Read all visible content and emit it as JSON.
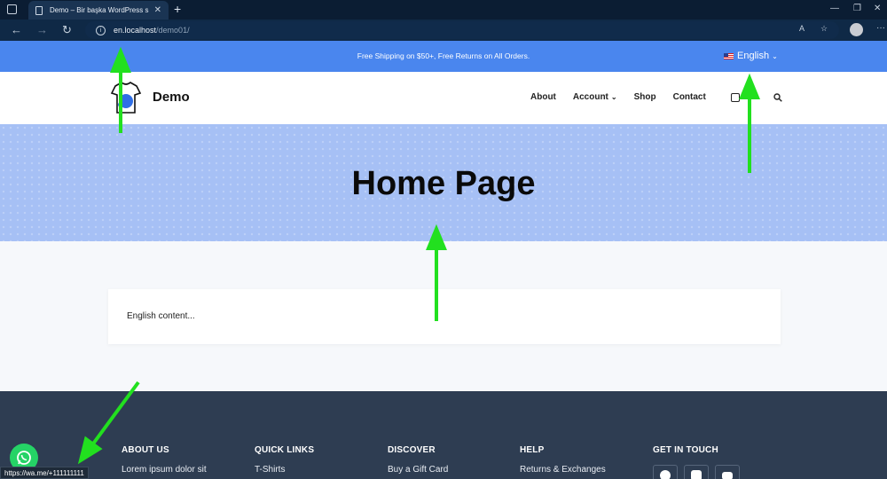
{
  "browser": {
    "tab_title": "Demo – Bir başka WordPress sit",
    "url_host": "en.localhost",
    "url_path": "/demo01/"
  },
  "topbar": {
    "promo": "Free Shipping on $50+, Free Returns on All Orders.",
    "language": "English"
  },
  "header": {
    "site_title": "Demo",
    "nav": [
      "About",
      "Account",
      "Shop",
      "Contact"
    ]
  },
  "hero": {
    "title": "Home Page"
  },
  "content": {
    "text": "English content..."
  },
  "footer": {
    "about": {
      "heading": "ABOUT US",
      "text": "Lorem ipsum dolor sit"
    },
    "quick_links": {
      "heading": "QUICK LINKS",
      "first": "T-Shirts"
    },
    "discover": {
      "heading": "DISCOVER",
      "first": "Buy a Gift Card"
    },
    "help": {
      "heading": "HELP",
      "first": "Returns & Exchanges"
    },
    "contact": {
      "heading": "GET IN TOUCH"
    }
  },
  "status_bar": {
    "url": "https://wa.me/+111111111"
  },
  "colors": {
    "topbar": "#4a86ee",
    "hero": "#a6c0f5",
    "footer": "#2e3d52",
    "whatsapp": "#25d366",
    "annotation_arrow": "#22e01f"
  },
  "icons": [
    "browser-menu-icon",
    "page-icon",
    "close-icon",
    "plus-icon",
    "back-icon",
    "forward-icon",
    "reload-icon",
    "info-icon",
    "read-aloud-icon",
    "favorite-icon",
    "profile-icon",
    "more-icon",
    "us-flag-icon",
    "chevron-down-icon",
    "cart-icon",
    "search-icon",
    "facebook-icon",
    "instagram-icon",
    "youtube-icon",
    "whatsapp-icon"
  ]
}
